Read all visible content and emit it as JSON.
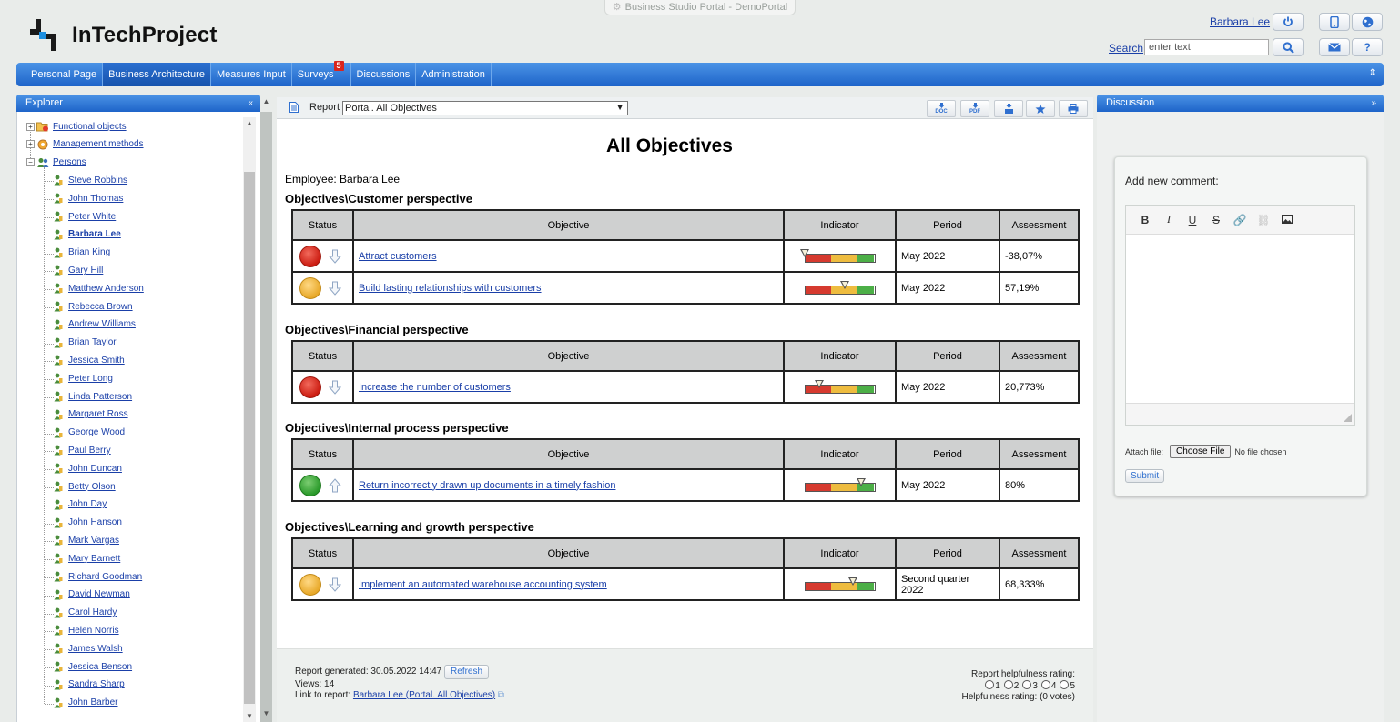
{
  "window_title": "Business Studio Portal - DemoPortal",
  "brand": {
    "name": "InTechProject"
  },
  "user": {
    "name": "Barbara Lee"
  },
  "search": {
    "link": "Search",
    "placeholder": "enter text"
  },
  "nav": {
    "items": [
      {
        "label": "Personal Page"
      },
      {
        "label": "Business Architecture",
        "active": true
      },
      {
        "label": "Measures Input"
      },
      {
        "label": "Surveys",
        "badge": "5"
      },
      {
        "label": "Discussions"
      },
      {
        "label": "Administration"
      }
    ]
  },
  "explorer": {
    "title": "Explorer",
    "folders": [
      {
        "label": "Functional objects",
        "expander": "+"
      },
      {
        "label": "Management methods",
        "expander": "+"
      },
      {
        "label": "Persons",
        "expander": "−"
      }
    ],
    "persons": [
      {
        "label": "Steve Robbins"
      },
      {
        "label": "John Thomas"
      },
      {
        "label": "Peter White"
      },
      {
        "label": "Barbara Lee",
        "selected": true
      },
      {
        "label": "Brian King"
      },
      {
        "label": "Gary Hill"
      },
      {
        "label": "Matthew Anderson"
      },
      {
        "label": "Rebecca Brown"
      },
      {
        "label": "Andrew Williams"
      },
      {
        "label": "Brian Taylor"
      },
      {
        "label": "Jessica Smith"
      },
      {
        "label": "Peter Long"
      },
      {
        "label": "Linda Patterson"
      },
      {
        "label": "Margaret Ross"
      },
      {
        "label": "George Wood"
      },
      {
        "label": "Paul Berry"
      },
      {
        "label": "John Duncan"
      },
      {
        "label": "Betty Olson"
      },
      {
        "label": "John Day"
      },
      {
        "label": "John Hanson"
      },
      {
        "label": "Mark Vargas"
      },
      {
        "label": "Mary Barnett"
      },
      {
        "label": "Richard Goodman"
      },
      {
        "label": "David Newman"
      },
      {
        "label": "Carol Hardy"
      },
      {
        "label": "Helen Norris"
      },
      {
        "label": "James Walsh"
      },
      {
        "label": "Jessica Benson"
      },
      {
        "label": "Sandra Sharp"
      },
      {
        "label": "John Barber"
      }
    ]
  },
  "report": {
    "label": "Report",
    "selected": "Portal. All Objectives",
    "export_buttons": [
      "DOC",
      "PDF",
      "",
      "",
      ""
    ],
    "title": "All Objectives",
    "employee": "Employee: Barbara Lee",
    "headers": {
      "status": "Status",
      "objective": "Objective",
      "indicator": "Indicator",
      "period": "Period",
      "assessment": "Assessment"
    },
    "sections": [
      {
        "title": "Objectives\\Customer perspective",
        "rows": [
          {
            "status": "red",
            "trend": "down",
            "objective": "Attract customers",
            "indicator_level": 0.0,
            "period": "May 2022",
            "assessment": "-38,07%"
          },
          {
            "status": "yellow",
            "trend": "down",
            "objective": "Build lasting relationships with customers",
            "indicator_level": 0.57,
            "period": "May 2022",
            "assessment": "57,19%"
          }
        ]
      },
      {
        "title": "Objectives\\Financial perspective",
        "rows": [
          {
            "status": "red",
            "trend": "down",
            "objective": "Increase the number of customers",
            "indicator_level": 0.21,
            "period": "May 2022",
            "assessment": "20,773%"
          }
        ]
      },
      {
        "title": "Objectives\\Internal process perspective",
        "rows": [
          {
            "status": "green",
            "trend": "up",
            "objective": "Return incorrectly drawn up documents in a timely fashion",
            "indicator_level": 0.8,
            "period": "May 2022",
            "assessment": "80%"
          }
        ]
      },
      {
        "title": "Objectives\\Learning and growth perspective",
        "rows": [
          {
            "status": "yellow",
            "trend": "down",
            "objective": "Implement an automated warehouse accounting system",
            "indicator_level": 0.68,
            "period": "Second quarter 2022",
            "assessment": "68,333%"
          }
        ]
      }
    ],
    "footer": {
      "generated": "Report generated: 30.05.2022 14:47",
      "refresh": "Refresh",
      "views": "Views: 14",
      "link_label": "Link to report:",
      "link_text": "Barbara Lee (Portal. All Objectives)",
      "rating_title": "Report helpfulness rating:",
      "rating_options": [
        "1",
        "2",
        "3",
        "4",
        "5"
      ],
      "rating_summary": "Helpfulness rating: (0 votes)"
    }
  },
  "discussion": {
    "title": "Discussion",
    "add_comment": "Add new comment:",
    "attach_label": "Attach file:",
    "choose_file": "Choose File",
    "no_file": "No file chosen",
    "submit": "Submit"
  },
  "colors": {
    "nav_blue": "#1e64c9",
    "status_red": "#cc1d12",
    "status_yellow": "#e8a92a",
    "status_green": "#2a9a2a",
    "link": "#1a3fa8"
  }
}
